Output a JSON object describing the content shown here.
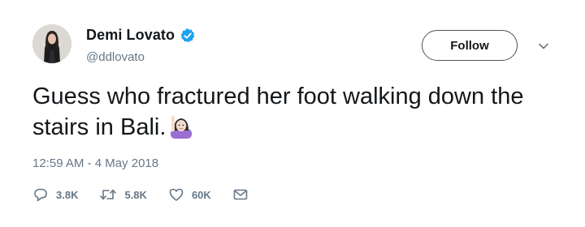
{
  "user": {
    "display_name": "Demi Lovato",
    "handle": "@ddlovato",
    "verified": true
  },
  "follow_button": {
    "label": "Follow"
  },
  "tweet": {
    "text": "Guess who fractured her foot walking down the stairs in Bali.",
    "emoji": "woman-raising-hand",
    "timestamp": "12:59 AM - 4 May 2018"
  },
  "actions": {
    "replies": "3.8K",
    "retweets": "5.8K",
    "likes": "60K"
  },
  "icons": {
    "verified": "verified-badge-icon",
    "menu": "chevron-down-icon",
    "reply": "reply-icon",
    "retweet": "retweet-icon",
    "like": "heart-icon",
    "message": "envelope-icon"
  },
  "colors": {
    "text": "#14171a",
    "secondary": "#657786",
    "verified": "#1da1f2",
    "follow_border": "#50575e"
  }
}
